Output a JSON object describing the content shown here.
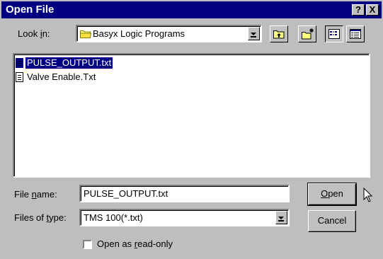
{
  "window": {
    "title": "Open File",
    "help": "?",
    "close": "X"
  },
  "look_in": {
    "label_pre": "Look ",
    "label_key": "i",
    "label_post": "n:",
    "value": "Basyx Logic Programs"
  },
  "toolbar": {
    "up_icon": "folder-up-icon",
    "new_folder_icon": "new-folder-icon",
    "list_icon": "list-view-icon",
    "details_icon": "details-view-icon"
  },
  "files": [
    {
      "name": "PULSE_OUTPUT.txt",
      "selected": true
    },
    {
      "name": "Valve Enable.Txt",
      "selected": false
    }
  ],
  "file_name": {
    "label_pre": "File ",
    "label_key": "n",
    "label_post": "ame:",
    "value": "PULSE_OUTPUT.txt"
  },
  "file_type": {
    "label_pre": "Files of ",
    "label_key": "t",
    "label_post": "ype:",
    "value": "TMS 100(*.txt)"
  },
  "buttons": {
    "open_key": "O",
    "open_rest": "pen",
    "cancel": "Cancel"
  },
  "readonly": {
    "pre": "Open as ",
    "key": "r",
    "post": "ead-only",
    "checked": false
  },
  "colors": {
    "titlebar": "#000080",
    "face": "#c0c0c0",
    "selection": "#000080"
  }
}
